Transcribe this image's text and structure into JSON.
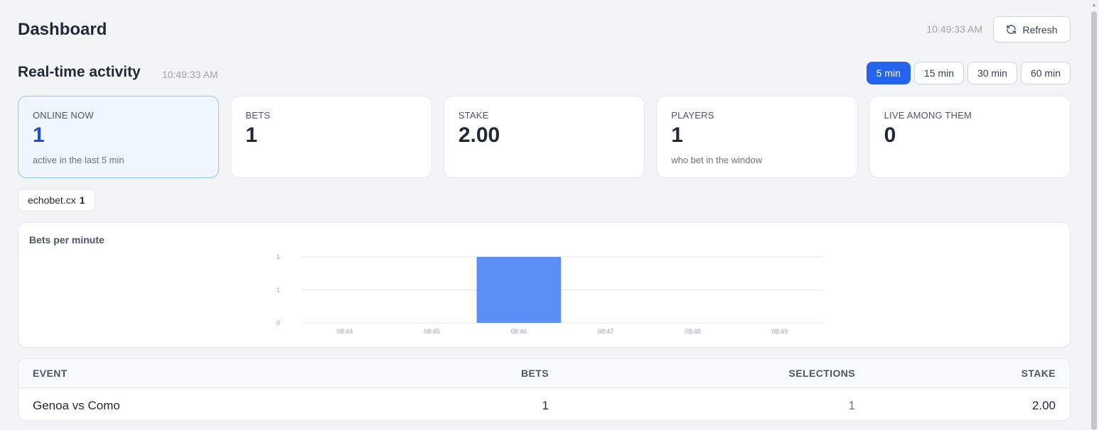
{
  "header": {
    "title": "Dashboard",
    "timestamp": "10:49:33 AM",
    "refresh_label": "Refresh",
    "refresh_icon": "refresh-icon"
  },
  "section": {
    "title": "Real-time activity",
    "timestamp": "10:49:33 AM",
    "ranges": [
      "5 min",
      "15 min",
      "30 min",
      "60 min"
    ],
    "active_range": "5 min"
  },
  "cards": [
    {
      "label": "ONLINE NOW",
      "value": "1",
      "sub": "active in the last 5 min"
    },
    {
      "label": "BETS",
      "value": "1",
      "sub": ""
    },
    {
      "label": "STAKE",
      "value": "2.00",
      "sub": ""
    },
    {
      "label": "PLAYERS",
      "value": "1",
      "sub": "who bet in the window"
    },
    {
      "label": "LIVE AMONG THEM",
      "value": "0",
      "sub": ""
    }
  ],
  "site_chip": {
    "name": "echobet.cx",
    "count": "1"
  },
  "chart_title": "Bets per minute",
  "chart_data": {
    "type": "bar",
    "categories": [
      "08:44",
      "08:45",
      "08:46",
      "08:47",
      "08:48",
      "08:49"
    ],
    "values": [
      0,
      0,
      1,
      0,
      0,
      0
    ],
    "ylim": [
      0,
      1
    ],
    "y_tick_labels": [
      "0",
      "1",
      "1"
    ],
    "grid": true,
    "bar_color": "#5b8ff5"
  },
  "table": {
    "columns": [
      "EVENT",
      "BETS",
      "SELECTIONS",
      "STAKE"
    ],
    "rows": [
      {
        "event": "Genoa vs Como",
        "bets": "1",
        "selections": "1",
        "stake": "2.00"
      }
    ]
  },
  "colors": {
    "accent": "#2563eb",
    "highlight_bg": "#eff6ff",
    "highlight_border": "#93c5fd"
  }
}
